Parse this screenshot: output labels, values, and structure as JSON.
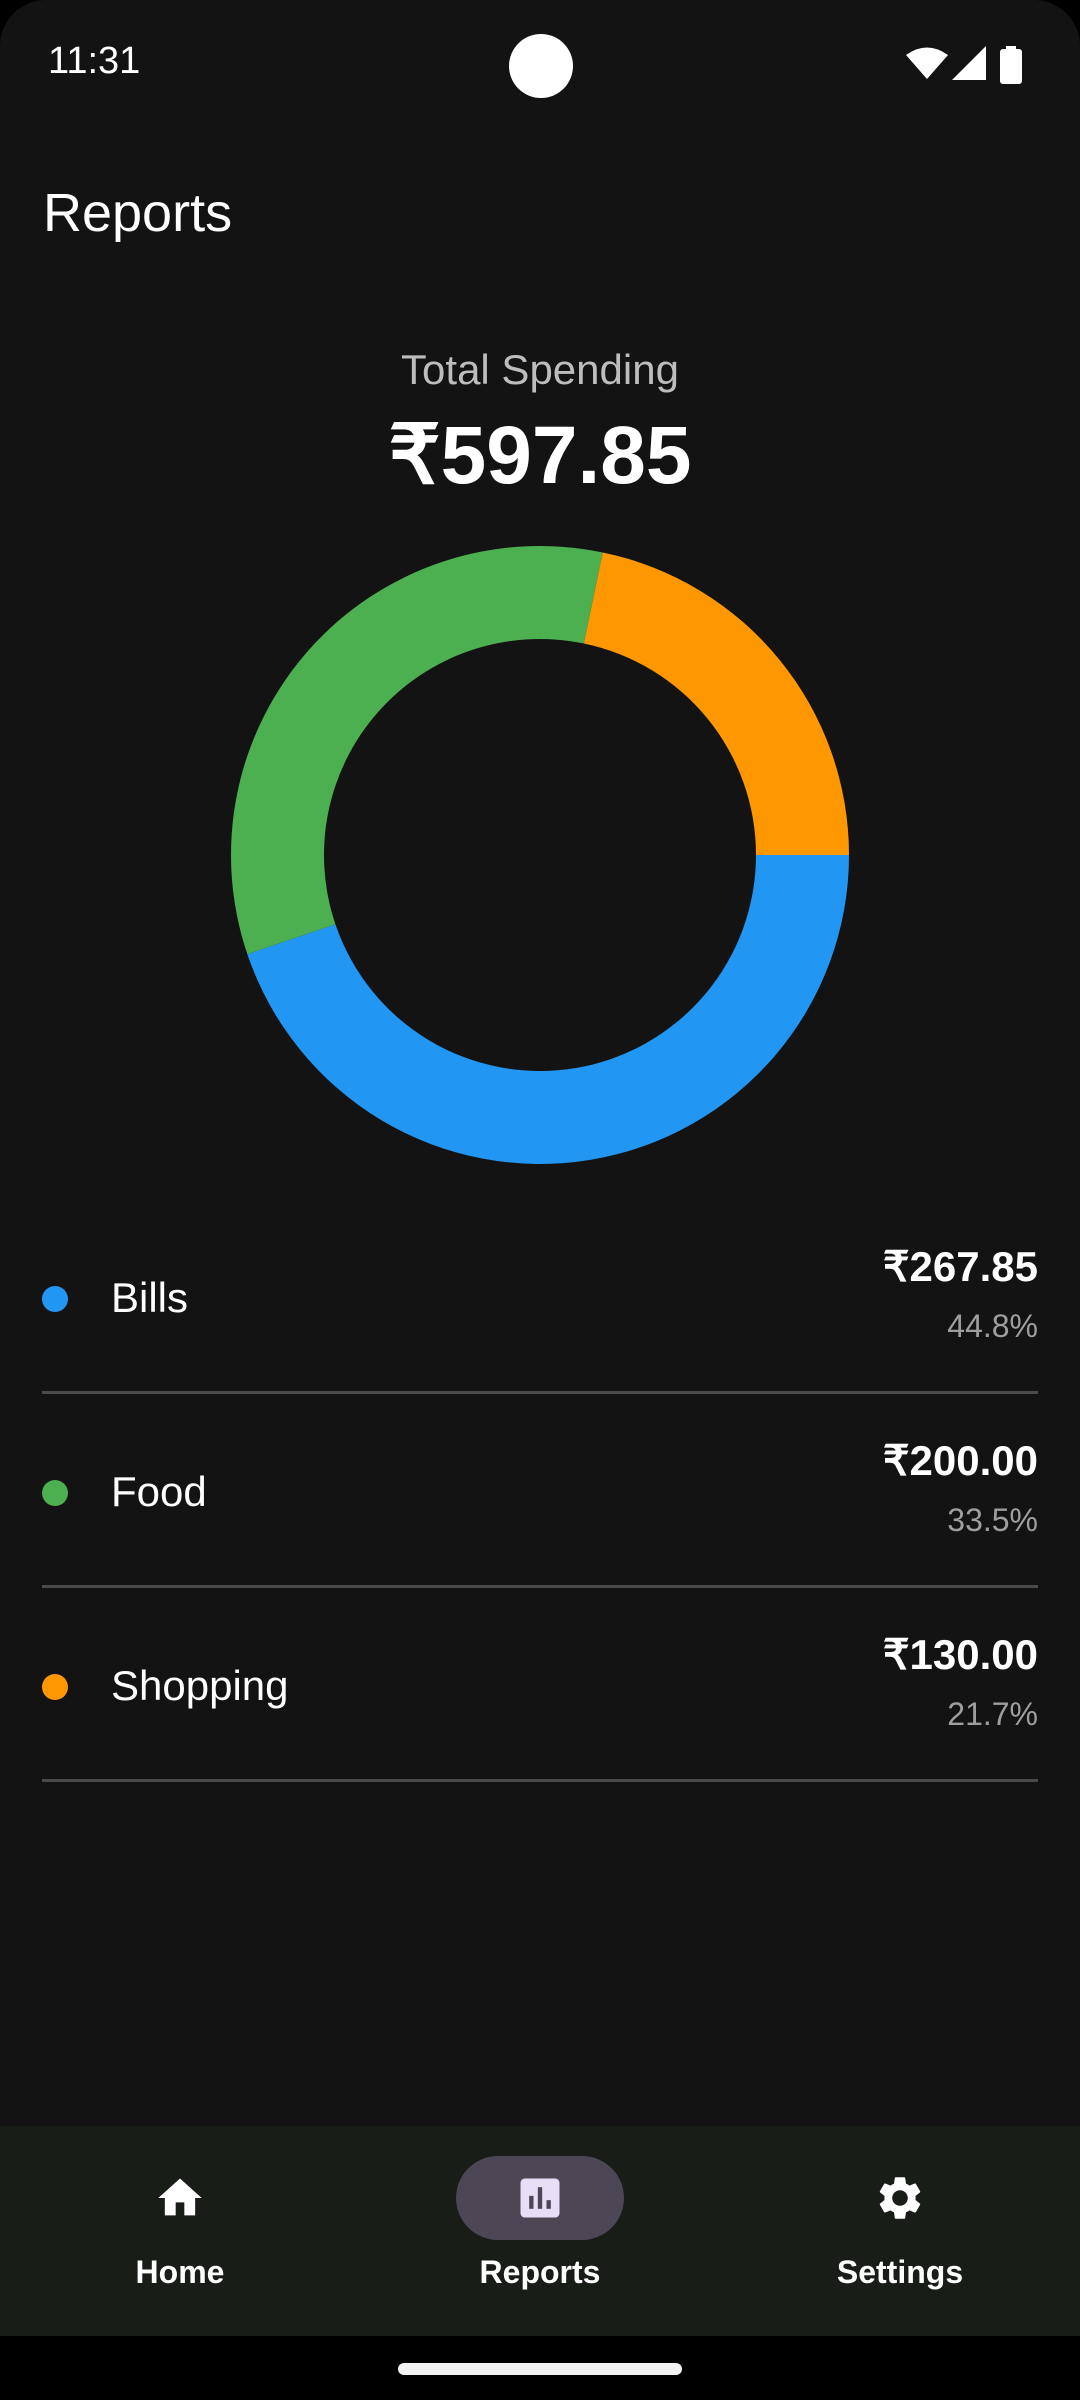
{
  "status_bar": {
    "time": "11:31"
  },
  "header": {
    "title": "Reports"
  },
  "summary": {
    "label": "Total Spending",
    "amount": "₹597.85"
  },
  "chart_data": {
    "type": "pie",
    "variant": "donut",
    "categories": [
      "Bills",
      "Food",
      "Shopping"
    ],
    "values": [
      267.85,
      200.0,
      130.0
    ],
    "percentages": [
      44.8,
      33.5,
      21.7
    ],
    "colors": [
      "#2196F3",
      "#4CAF50",
      "#FF9800"
    ],
    "title": "",
    "legend": "below"
  },
  "legend": [
    {
      "name": "Bills",
      "amount": "₹267.85",
      "percent": "44.8%",
      "color": "#2196F3"
    },
    {
      "name": "Food",
      "amount": "₹200.00",
      "percent": "33.5%",
      "color": "#4CAF50"
    },
    {
      "name": "Shopping",
      "amount": "₹130.00",
      "percent": "21.7%",
      "color": "#FF9800"
    }
  ],
  "nav": {
    "items": [
      {
        "label": "Home",
        "icon": "home-icon",
        "active": false
      },
      {
        "label": "Reports",
        "icon": "bar-chart-icon",
        "active": true
      },
      {
        "label": "Settings",
        "icon": "gear-icon",
        "active": false
      }
    ]
  }
}
